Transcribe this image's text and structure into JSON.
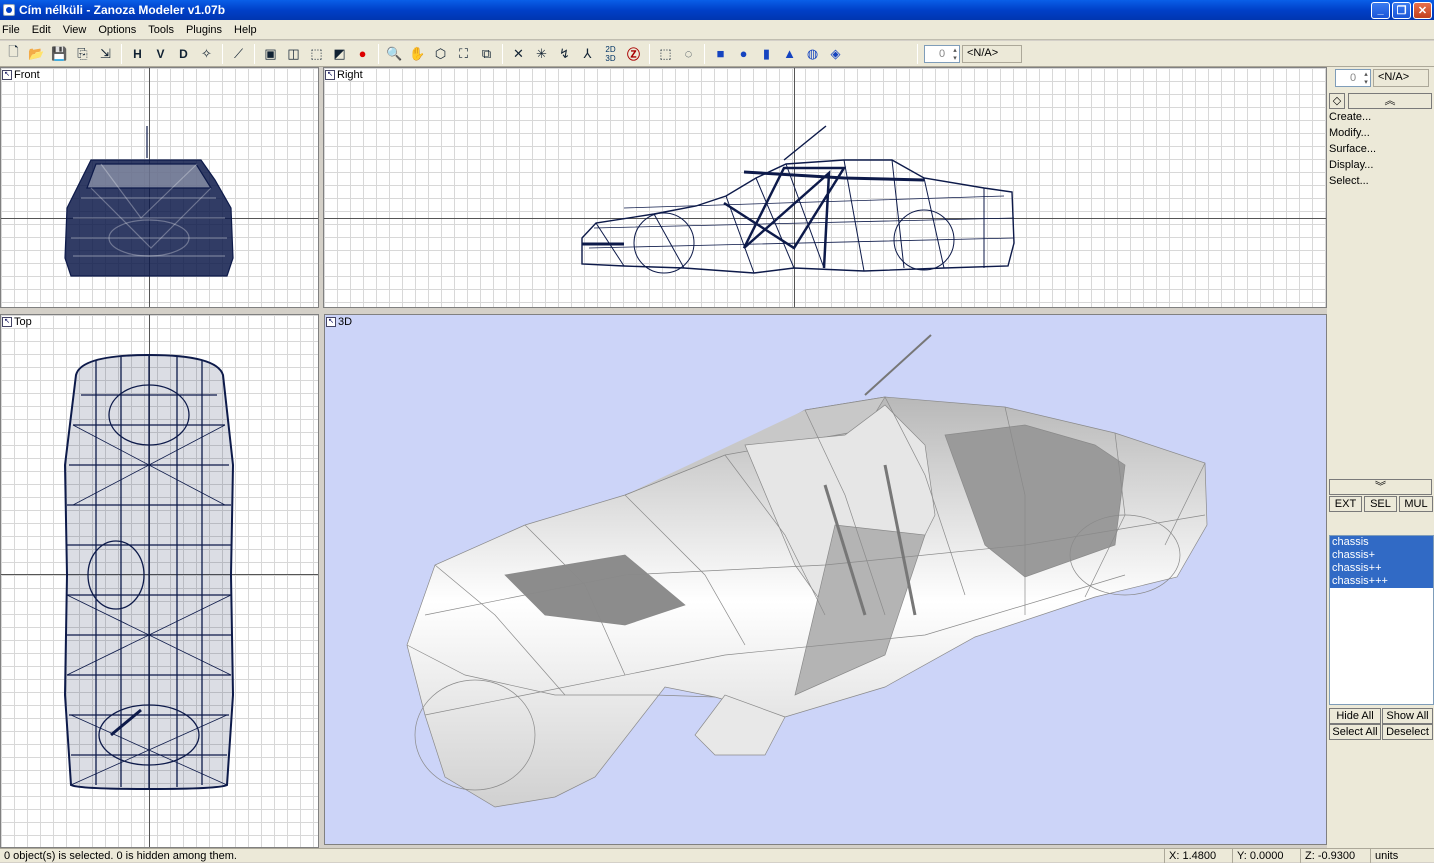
{
  "window": {
    "title": "Cím nélküli - Zanoza Modeler v1.07b"
  },
  "menu": [
    "File",
    "Edit",
    "View",
    "Options",
    "Tools",
    "Plugins",
    "Help"
  ],
  "toolbar": {
    "letters": [
      "H",
      "V",
      "D"
    ],
    "spinner_value": "0",
    "nav_value": "<N/A>"
  },
  "viewports": {
    "front": "Front",
    "right": "Right",
    "top": "Top",
    "perspective": "3D"
  },
  "panel": {
    "spinner_value": "0",
    "nav_value": "<N/A>",
    "menu": [
      "Create...",
      "Modify...",
      "Surface...",
      "Display...",
      "Select..."
    ],
    "mode_buttons": [
      "EXT",
      "SEL",
      "MUL"
    ],
    "objects": [
      "chassis",
      "chassis+",
      "chassis++",
      "chassis+++"
    ],
    "actions": [
      "Hide All",
      "Show All",
      "Select All",
      "Deselect"
    ]
  },
  "status": {
    "message": "0 object(s) is selected. 0 is hidden among them.",
    "x": "X: 1.4800",
    "y": "Y: 0.0000",
    "z": "Z: -0.9300",
    "units": "units"
  },
  "colors": {
    "wireframe": "#0d1a4a",
    "viewport_3d_bg": "#ccd4f8",
    "selection": "#316ac5"
  }
}
